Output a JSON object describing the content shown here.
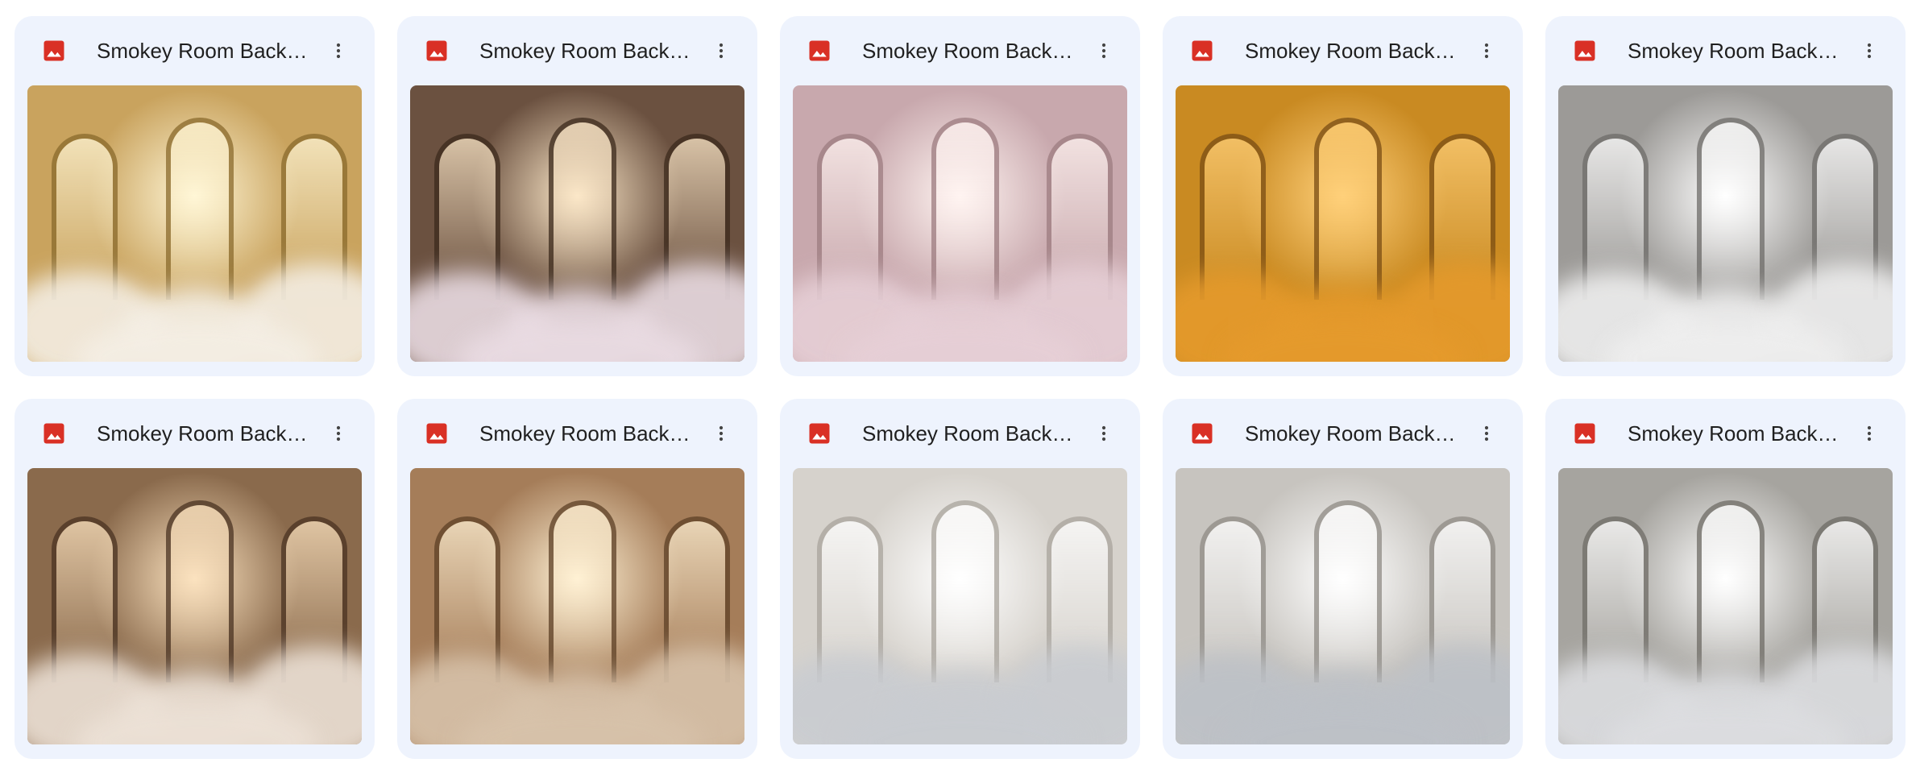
{
  "files": [
    {
      "name": "Smokey Room Backdrop",
      "icon": "image-file-icon",
      "more_icon": "more-vert-icon",
      "palette": {
        "bg": "#c9a35e",
        "glow": "#fff6d6",
        "cloud": "#f4eee4",
        "arch": "#8a6a2c"
      }
    },
    {
      "name": "Smokey Room Backdrop",
      "icon": "image-file-icon",
      "more_icon": "more-vert-icon",
      "palette": {
        "bg": "#6b5140",
        "glow": "#fbe7c8",
        "cloud": "#e9dbe2",
        "arch": "#3c2a1c"
      }
    },
    {
      "name": "Smokey Room Backdrop",
      "icon": "image-file-icon",
      "more_icon": "more-vert-icon",
      "palette": {
        "bg": "#c8a8ad",
        "glow": "#fff4f1",
        "cloud": "#e6cfd6",
        "arch": "#9d7c80"
      }
    },
    {
      "name": "Smokey Room Backdrop",
      "icon": "image-file-icon",
      "more_icon": "more-vert-icon",
      "palette": {
        "bg": "#c98a22",
        "glow": "#ffd07a",
        "cloud": "#e59a2c",
        "arch": "#7a4d14"
      }
    },
    {
      "name": "Smokey Room Backdrop",
      "icon": "image-file-icon",
      "more_icon": "more-vert-icon",
      "palette": {
        "bg": "#9c9a97",
        "glow": "#ffffff",
        "cloud": "#eeeeee",
        "arch": "#6e6c69"
      }
    },
    {
      "name": "Smokey Room Backdrop",
      "icon": "image-file-icon",
      "more_icon": "more-vert-icon",
      "palette": {
        "bg": "#8a6a4c",
        "glow": "#fbe2bf",
        "cloud": "#ece1d6",
        "arch": "#4a3322"
      }
    },
    {
      "name": "Smokey Room Backdrop",
      "icon": "image-file-icon",
      "more_icon": "more-vert-icon",
      "palette": {
        "bg": "#a57d59",
        "glow": "#fff1d4",
        "cloud": "#d7c2aa",
        "arch": "#5d4026"
      }
    },
    {
      "name": "Smokey Room Backdrop",
      "icon": "image-file-icon",
      "more_icon": "more-vert-icon",
      "palette": {
        "bg": "#d6d2cc",
        "glow": "#ffffff",
        "cloud": "#c9ccd1",
        "arch": "#a9a49c"
      }
    },
    {
      "name": "Smokey Room Backdrop",
      "icon": "image-file-icon",
      "more_icon": "more-vert-icon",
      "palette": {
        "bg": "#c7c4bf",
        "glow": "#ffffff",
        "cloud": "#bdc1c7",
        "arch": "#8f8b85"
      }
    },
    {
      "name": "Smokey Room Backdrop",
      "icon": "image-file-icon",
      "more_icon": "more-vert-icon",
      "palette": {
        "bg": "#a6a49f",
        "glow": "#ffffff",
        "cloud": "#dcdde0",
        "arch": "#6f6c66"
      }
    }
  ],
  "colors": {
    "card_bg": "#eef3fd",
    "icon_red": "#d93025",
    "text": "#1f1f1f"
  }
}
